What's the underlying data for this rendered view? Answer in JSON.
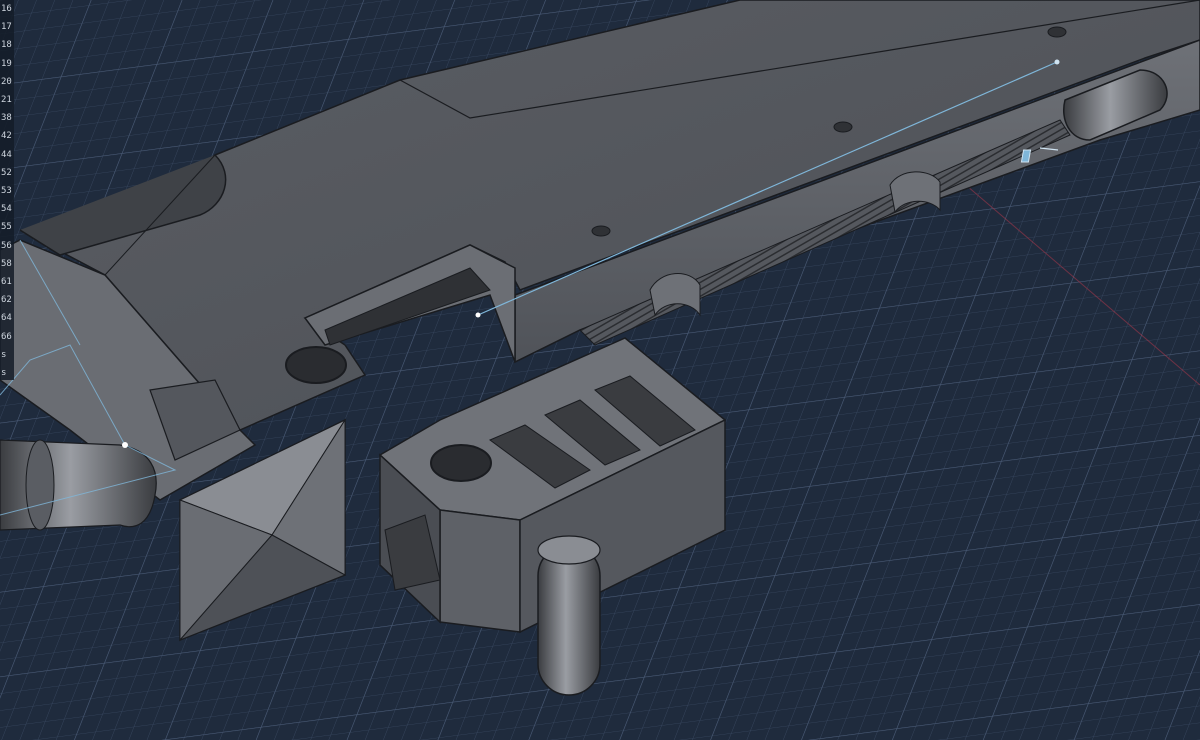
{
  "window": {
    "view": "3d-cad-viewport"
  },
  "ruler": {
    "items": [
      "16",
      "17",
      "18",
      "19",
      "20",
      "21",
      "38",
      "42",
      "44",
      "52",
      "53",
      "54",
      "55",
      "56",
      "58",
      "61",
      "62",
      "64",
      "66",
      "s",
      "s"
    ]
  },
  "colors": {
    "background": "#1f2b3d",
    "grid": "#3a4a63",
    "part": "#5f6268",
    "part_light": "#7b7e84",
    "part_dark": "#3e4046",
    "edge": "#1a1c20",
    "highlight": "#7fb6d9",
    "axis_red": "#a2374a"
  },
  "icons": {
    "gizmo": "manipulator-icon"
  }
}
